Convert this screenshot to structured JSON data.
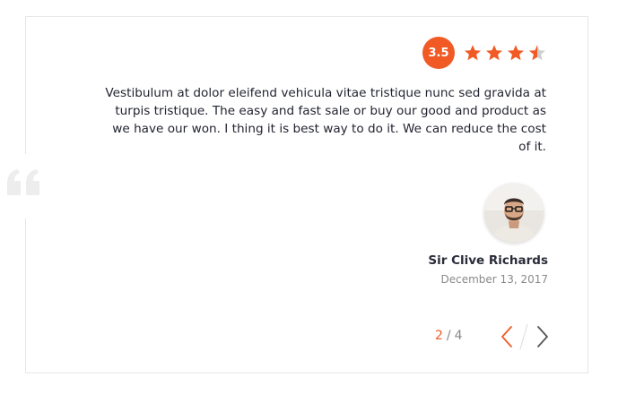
{
  "colors": {
    "accent": "#f15a24",
    "star_empty": "#cfcfcf",
    "text": "#222431",
    "muted": "#8a8a8a",
    "border": "#e6e6e6",
    "quote_mark": "#ededed"
  },
  "testimonial": {
    "rating": {
      "value": "3.5",
      "stars_total": 4,
      "stars_filled": 3.5
    },
    "quote_icon": "quote-open-icon",
    "text": "Vestibulum at dolor eleifend vehicula vitae tristique nunc sed gravida at turpis tristique. The easy and fast sale or buy our good and product as we have our won. I thing it is best way to do it. We can reduce the cost of it.",
    "reviewer": {
      "name": "Sir Clive Richards",
      "date": "December 13, 2017",
      "avatar_icon": "person-avatar"
    }
  },
  "pagination": {
    "current": "2",
    "separator": "/",
    "total": "4",
    "prev_icon": "chevron-left-icon",
    "next_icon": "chevron-right-icon"
  }
}
